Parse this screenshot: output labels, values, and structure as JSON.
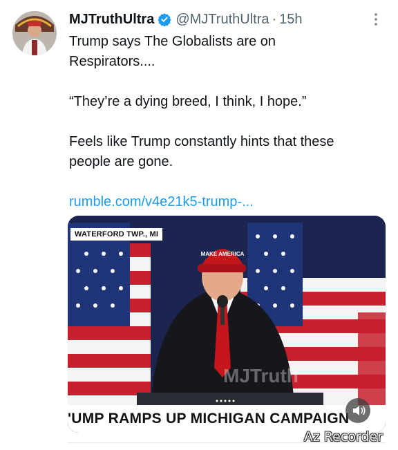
{
  "tweet": {
    "display_name": "MJTruthUltra",
    "handle": "@MJTruthUltra",
    "separator": "·",
    "time": "15h",
    "verified_color": "#1d9bf0",
    "text_line1": "Trump says The Globalists are on",
    "text_line2": "Respirators....",
    "quote": "“They’re a dying breed, I think, I hope.”",
    "comment_line1": "Feels like Trump constantly hints that these",
    "comment_line2": "people are gone.",
    "link": "rumble.com/v4e21k5-trump-..."
  },
  "media": {
    "location_chip": "WATERFORD TWP., MI",
    "chyron": "'UMP RAMPS UP MICHIGAN CAMPAIGN",
    "overlay_watermark": "MJTruth",
    "sound_icon": "speaker-icon"
  },
  "recorder_watermark": "Az Recorder"
}
